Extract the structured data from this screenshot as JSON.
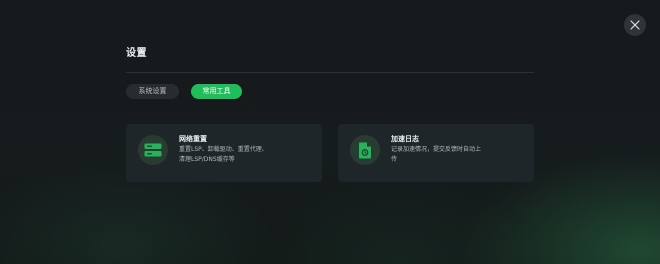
{
  "header": {
    "title": "设置",
    "close_icon": "close-icon"
  },
  "tabs": [
    {
      "label": "系统设置",
      "active": false
    },
    {
      "label": "常用工具",
      "active": true
    }
  ],
  "cards": [
    {
      "title": "网络重置",
      "desc_line1": "重置LSP、卸载驱动、重置代理、",
      "desc_line2": "清理LSP/DNS缓存等",
      "icon": "server-reset-icon"
    },
    {
      "title": "加速日志",
      "desc_line1": "记录加速情况，提交反馈时自动上",
      "desc_line2": "传",
      "icon": "log-document-icon"
    }
  ],
  "colors": {
    "accent": "#1fbe5a",
    "icon_green": "#27b35b",
    "card_bg": "#1f2629",
    "background": "#15191c"
  }
}
